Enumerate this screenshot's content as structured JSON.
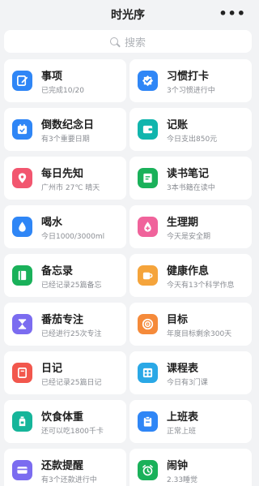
{
  "header": {
    "title": "时光序",
    "more_label": "•••"
  },
  "search": {
    "placeholder": "搜索"
  },
  "cards": [
    {
      "name": "事项",
      "sub": "已完成10/20",
      "color": "#2f86f6",
      "icon": "edit-icon"
    },
    {
      "name": "习惯打卡",
      "sub": "3个习惯进行中",
      "color": "#2f86f6",
      "icon": "check-badge-icon"
    },
    {
      "name": "倒数纪念日",
      "sub": "有3个重要日期",
      "color": "#2f86f6",
      "icon": "calendar-icon"
    },
    {
      "name": "记账",
      "sub": "今日支出850元",
      "color": "#11b5ad",
      "icon": "wallet-icon"
    },
    {
      "name": "每日先知",
      "sub": "广州市 27℃ 晴天",
      "color": "#f2566f",
      "icon": "location-pin-icon"
    },
    {
      "name": "读书笔记",
      "sub": "3本书籍在读中",
      "color": "#1ab15a",
      "icon": "book-icon"
    },
    {
      "name": "喝水",
      "sub": "今日1000/3000ml",
      "color": "#2f86f6",
      "icon": "water-drop-icon"
    },
    {
      "name": "生理期",
      "sub": "今天是安全期",
      "color": "#f0639b",
      "icon": "drop-plus-icon"
    },
    {
      "name": "备忘录",
      "sub": "已经记录25篇备忘",
      "color": "#1ab15a",
      "icon": "notebook-icon"
    },
    {
      "name": "健康作息",
      "sub": "今天有13个科学作息",
      "color": "#f5a43b",
      "icon": "cup-icon"
    },
    {
      "name": "番茄专注",
      "sub": "已经进行25次专注",
      "color": "#7b6cf0",
      "icon": "hourglass-icon"
    },
    {
      "name": "目标",
      "sub": "年度目标剩余300天",
      "color": "#f58a3a",
      "icon": "target-icon"
    },
    {
      "name": "日记",
      "sub": "已经记录25篇日记",
      "color": "#f2574d",
      "icon": "diary-icon"
    },
    {
      "name": "课程表",
      "sub": "今日有3门课",
      "color": "#2aa8e6",
      "icon": "grid-icon"
    },
    {
      "name": "饮食体重",
      "sub": "还可以吃1800千卡",
      "color": "#16b59a",
      "icon": "bottle-icon"
    },
    {
      "name": "上班表",
      "sub": "正常上班",
      "color": "#2f86f6",
      "icon": "clipboard-icon"
    },
    {
      "name": "还款提醒",
      "sub": "有3个还款进行中",
      "color": "#7b6cf0",
      "icon": "card-icon"
    },
    {
      "name": "闹钟",
      "sub": "2.33睡觉",
      "color": "#1ab15a",
      "icon": "alarm-clock-icon"
    }
  ]
}
